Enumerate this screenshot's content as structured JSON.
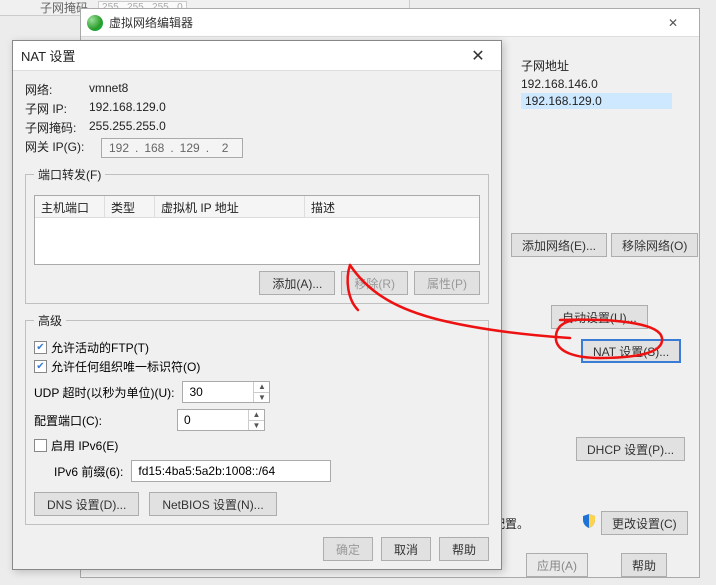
{
  "fragment": {
    "label": "子网掩码",
    "ip": "255 . 255 . 255 . 0"
  },
  "editor": {
    "title": "虚拟网络编辑器",
    "col_subnet": "子网地址",
    "row1": "192.168.146.0",
    "row2": "192.168.129.0",
    "add_net": "添加网络(E)...",
    "rem_net": "移除网络(O)",
    "auto_set": "自动设置(U)...",
    "nat_set": "NAT 设置(S)...",
    "dhcp_set": "DHCP 设置(P)...",
    "msg": "络配置。",
    "change": "更改设置(C)",
    "apply": "应用(A)",
    "help": "帮助"
  },
  "nat": {
    "title": "NAT 设置",
    "close": "✕",
    "net_lbl": "网络:",
    "net_val": "vmnet8",
    "subnet_lbl": "子网 IP:",
    "subnet_val": "192.168.129.0",
    "mask_lbl": "子网掩码:",
    "mask_val": "255.255.255.0",
    "gw_lbl": "网关 IP(G):",
    "gw": {
      "a": "192",
      "b": "168",
      "c": "129",
      "d": "2"
    },
    "pf_legend": "端口转发(F)",
    "pf_col1": "主机端口",
    "pf_col2": "类型",
    "pf_col3": "虚拟机 IP 地址",
    "pf_col4": "描述",
    "pf_add": "添加(A)...",
    "pf_remove": "移除(R)",
    "pf_prop": "属性(P)",
    "adv_legend": "高级",
    "chk_ftp": "允许活动的FTP(T)",
    "chk_oui": "允许任何组织唯一标识符(O)",
    "udp_lbl": "UDP 超时(以秒为单位)(U):",
    "udp_val": "30",
    "cfg_lbl": "配置端口(C):",
    "cfg_val": "0",
    "chk_ipv6": "启用 IPv6(E)",
    "ipv6_lbl": "IPv6 前缀(6):",
    "ipv6_val": "fd15:4ba5:5a2b:1008::/64",
    "dns_btn": "DNS 设置(D)...",
    "nb_btn": "NetBIOS 设置(N)...",
    "ok": "确定",
    "cancel": "取消",
    "help": "帮助"
  }
}
